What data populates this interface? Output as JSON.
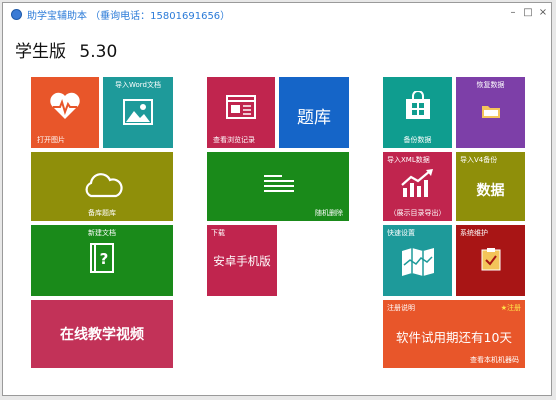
{
  "window": {
    "title": "助学宝辅助本 （垂询电话：15801691656）",
    "minimize_glyph": "–",
    "maximize_glyph": "□",
    "close_glyph": "×"
  },
  "heading": {
    "edition": "学生版",
    "version": "5.30"
  },
  "tiles": {
    "open_image": {
      "label": "打开图片",
      "color": "#e8562a",
      "icon": "heartbeat-icon"
    },
    "import_word": {
      "label": "导入Word文档",
      "color": "#1e9a9a",
      "icon": "picture-icon"
    },
    "view_history": {
      "label": "查看浏览记录",
      "color": "#c0254e",
      "icon": "newspaper-icon"
    },
    "question_bank": {
      "label": "题库",
      "color": "#1565c8"
    },
    "backup": {
      "label": "备份数据",
      "color": "#0f9d8f",
      "icon": "store-bag-icon"
    },
    "restore": {
      "label": "恢复数据",
      "color": "#7d3fa8",
      "icon": "folder-icon"
    },
    "cloud": {
      "label": "备库题库",
      "color": "#8f8f0a",
      "icon": "cloud-icon"
    },
    "random_delete": {
      "label": "随机删除",
      "color": "#1a8a1a",
      "icon": "lines-icon"
    },
    "import_xml": {
      "label": "导入XML数据",
      "sublabel": "（展示目录导出）",
      "color": "#c0254e",
      "icon": "chart-up-icon"
    },
    "import_v4": {
      "label": "导入V4备份",
      "big": "数据",
      "color": "#8f8f0a"
    },
    "new_file": {
      "label": "新建文档",
      "color": "#1a8a1a",
      "icon": "question-book-icon"
    },
    "download": {
      "label": "下载",
      "big": "安卓手机版",
      "color": "#c0254e"
    },
    "quick_setup": {
      "label": "快速设置",
      "color": "#1e9a9a",
      "icon": "map-icon"
    },
    "system_maint": {
      "label": "系统维护",
      "color": "#a81515",
      "icon": "clipboard-icon"
    },
    "online_video": {
      "big": "在线教学视频",
      "color": "#c23258"
    },
    "register": {
      "label": "注册说明",
      "badge": "★注册",
      "big": "软件试用期还有10天",
      "footer": "查看本机机器码",
      "color": "#e8562a"
    }
  }
}
